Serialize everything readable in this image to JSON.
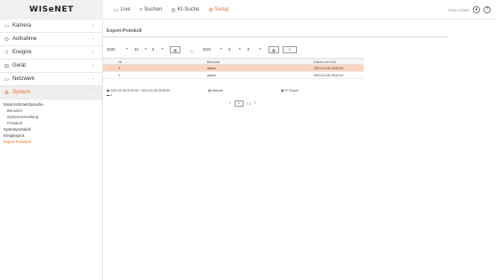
{
  "app": {
    "logo": "WISeNET",
    "top_nav": [
      {
        "label": "Live",
        "icon": "monitor-icon"
      },
      {
        "label": "Suchen",
        "icon": "search-icon"
      },
      {
        "label": "KI-Suche",
        "icon": "ai-search-icon"
      },
      {
        "label": "Setup",
        "icon": "gear-icon"
      }
    ],
    "active_nav": "Setup",
    "user": "PRN-STORE",
    "accent_color": "#f36b21"
  },
  "sidebar": {
    "items": [
      {
        "label": "Kamera",
        "icon": "camera-icon"
      },
      {
        "label": "Aufnahme",
        "icon": "record-icon"
      },
      {
        "label": "Ereignis",
        "icon": "bell-icon"
      },
      {
        "label": "Gerät",
        "icon": "device-icon"
      },
      {
        "label": "Netzwerk",
        "icon": "network-icon"
      },
      {
        "label": "System",
        "icon": "gear-icon"
      }
    ],
    "submenu": [
      "Datum/Uhrzeit/Sprache",
      "Benutzer",
      "Systemverwaltung",
      "Protokoll",
      "Systemprotokoll",
      "Ereignisprot.",
      "Export-Protokoll"
    ]
  },
  "page": {
    "title": "Export-Protokoll"
  },
  "filter": {
    "start_year": "2020",
    "start_month": "12",
    "start_day": "3",
    "separator": "~",
    "end_year": "2021",
    "end_month": "2",
    "end_day": "3"
  },
  "table": {
    "columns": [
      "Nr.",
      "Benutzer",
      "Datum und Zeit"
    ],
    "rows": [
      {
        "no": "2",
        "user": "admin",
        "date": "2021-01-06 19:51:23"
      },
      {
        "no": "1",
        "user": "admin",
        "date": "2021-01-06 19:51:03"
      }
    ],
    "selected_row": 0
  },
  "legend": {
    "range": "2021-01-06 00:00:00 ~ 2021-01-06 23:59:59",
    "channel": "1",
    "network": "Network",
    "export": "PC Export"
  },
  "pagination": {
    "current": "1",
    "total": "/ 1"
  }
}
